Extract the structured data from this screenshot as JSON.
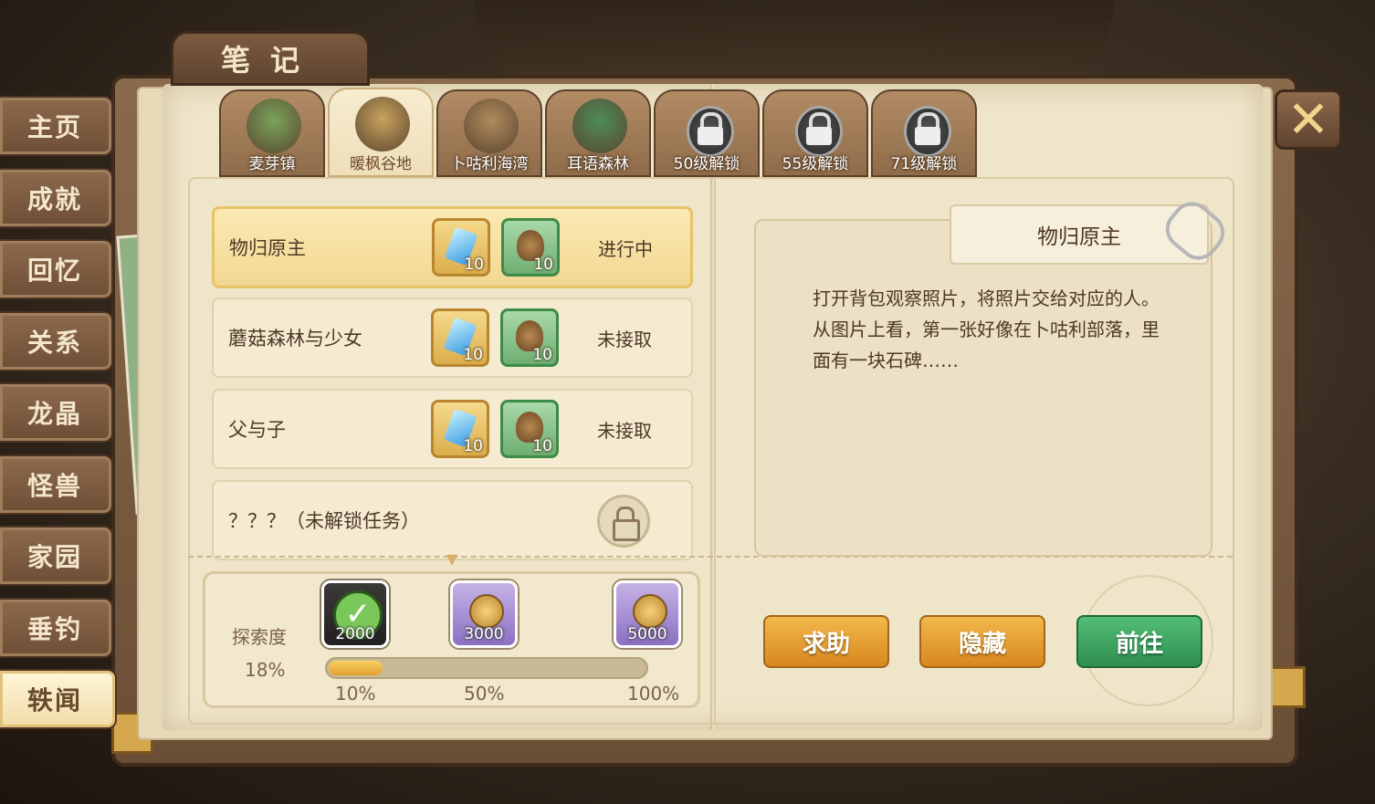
{
  "title": "笔记",
  "side_tabs": [
    {
      "label": "主页"
    },
    {
      "label": "成就"
    },
    {
      "label": "回忆"
    },
    {
      "label": "关系"
    },
    {
      "label": "龙晶"
    },
    {
      "label": "怪兽"
    },
    {
      "label": "家园"
    },
    {
      "label": "垂钓"
    },
    {
      "label": "轶闻",
      "active": true
    }
  ],
  "map_tabs": [
    {
      "label": "麦芽镇",
      "icon": "town-icon",
      "color": "#7aa35a"
    },
    {
      "label": "暖枫谷地",
      "icon": "valley-icon",
      "color": "#c9a35d",
      "active": true
    },
    {
      "label": "卜咕利海湾",
      "icon": "bay-icon",
      "color": "#b08a5c"
    },
    {
      "label": "耳语森林",
      "icon": "forest-icon",
      "color": "#4e8c5a"
    },
    {
      "label": "50级解锁",
      "icon": "lock-icon",
      "locked": true
    },
    {
      "label": "55级解锁",
      "icon": "lock-icon",
      "locked": true
    },
    {
      "label": "71级解锁",
      "icon": "lock-icon",
      "locked": true
    }
  ],
  "quests": [
    {
      "name": "物归原主",
      "reward1": "10",
      "reward2": "10",
      "status": "进行中",
      "active": true
    },
    {
      "name": "蘑菇森林与少女",
      "reward1": "10",
      "reward2": "10",
      "status": "未接取"
    },
    {
      "name": "父与子",
      "reward1": "10",
      "reward2": "10",
      "status": "未接取"
    },
    {
      "name": "？？？（未解锁任务）",
      "locked": true
    }
  ],
  "exploration": {
    "label": "探索度",
    "percent_text": "18%",
    "progress": 0.18,
    "milestones": [
      {
        "label": "10%",
        "reward": "2000",
        "claimed": true
      },
      {
        "label": "50%",
        "reward": "3000",
        "claimed": false
      },
      {
        "label": "100%",
        "reward": "5000",
        "claimed": false
      }
    ]
  },
  "detail": {
    "title": "物归原主",
    "lines": [
      "打开背包观察照片，将照片交给对应的人。",
      "从图片上看，第一张好像在卜咕利部落，里面有一块石碑……"
    ]
  },
  "buttons": {
    "help": "求助",
    "hide": "隐藏",
    "go": "前往"
  },
  "close_symbol": "✕",
  "colors": {
    "accent_orange": "#d7881f",
    "accent_green": "#2f8f51",
    "page": "#efe5c9"
  }
}
